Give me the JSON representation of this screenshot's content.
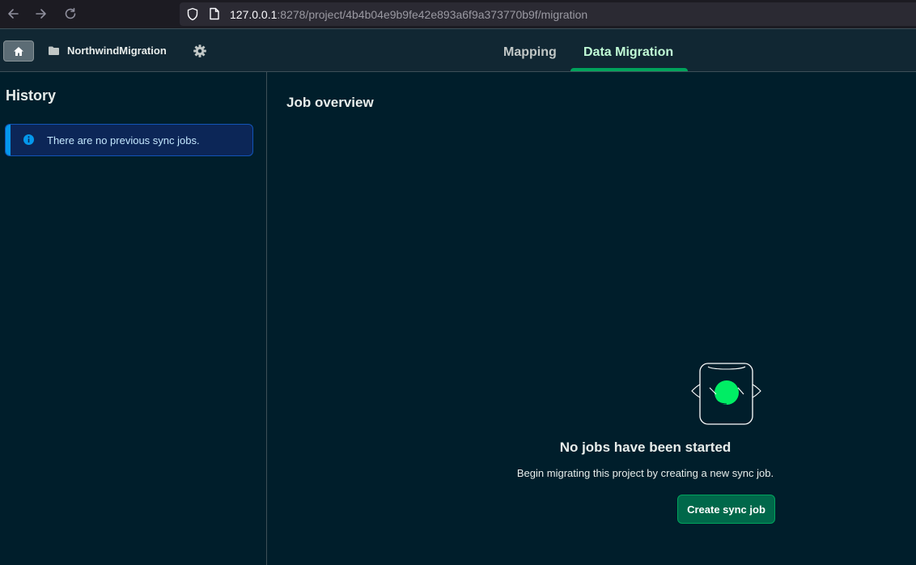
{
  "browser": {
    "url_host": "127.0.0.1",
    "url_rest": ":8278/project/4b4b04e9b9fe42e893a6f9a373770b9f/migration"
  },
  "header": {
    "project_name": "NorthwindMigration",
    "tabs": [
      {
        "label": "Mapping",
        "active": false
      },
      {
        "label": "Data Migration",
        "active": true
      }
    ]
  },
  "sidebar": {
    "title": "History",
    "info_message": "There are no previous sync jobs."
  },
  "main": {
    "title": "Job overview",
    "empty_state": {
      "title": "No jobs have been started",
      "description": "Begin migrating this project by creating a new sync job.",
      "button_label": "Create sync job"
    }
  },
  "colors": {
    "background": "#001e2b",
    "accent": "#00a35c",
    "active_tab": "#c0fad6",
    "info": "#0498ec"
  }
}
